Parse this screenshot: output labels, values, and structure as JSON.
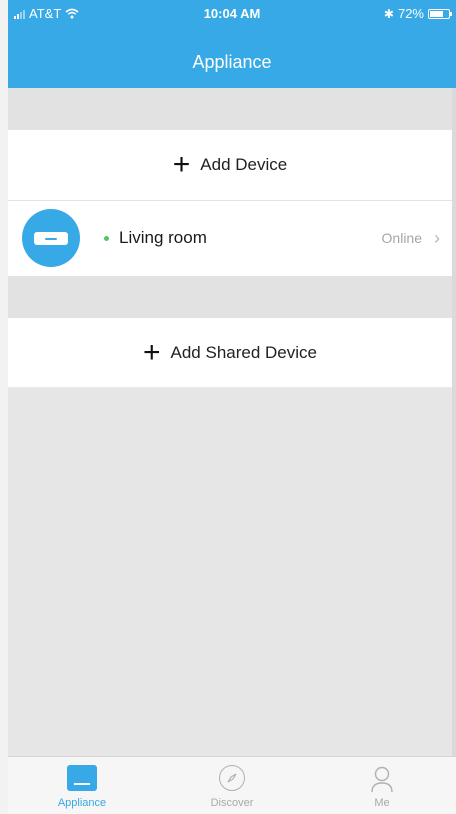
{
  "status_bar": {
    "carrier": "AT&T",
    "time": "10:04 AM",
    "battery": "72%",
    "battery_level": 0.72
  },
  "header": {
    "title": "Appliance"
  },
  "add_device": {
    "label": "Add Device"
  },
  "device": {
    "name": "Living room",
    "status": "Online"
  },
  "add_shared_device": {
    "label": "Add Shared Device"
  },
  "tabs": [
    {
      "label": "Appliance",
      "icon": "appliance-icon"
    },
    {
      "label": "Discover",
      "icon": "compass-icon"
    },
    {
      "label": "Me",
      "icon": "person-icon"
    }
  ],
  "colors": {
    "accent": "#36a9e6",
    "online": "#55c26a"
  }
}
